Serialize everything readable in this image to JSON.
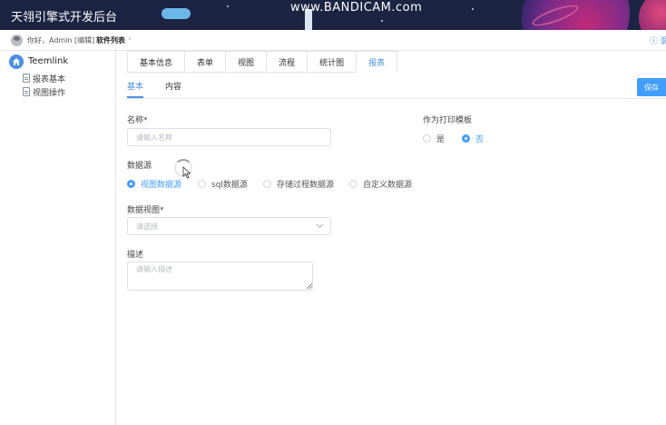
{
  "header": {
    "app_title": "天翎引擎式开发后台",
    "watermark": "www.BANDICAM.com"
  },
  "topbar": {
    "greeting": "你好，Admin [编辑]",
    "breadcrumb": "软件列表",
    "right_text": "ⓘ 调"
  },
  "sidebar": {
    "root_label": "Teemlink",
    "items": [
      {
        "label": "报表基本"
      },
      {
        "label": "视图操作"
      }
    ]
  },
  "tabs": [
    {
      "label": "基本信息",
      "active": false
    },
    {
      "label": "表单",
      "active": false
    },
    {
      "label": "视图",
      "active": false
    },
    {
      "label": "流程",
      "active": false
    },
    {
      "label": "统计图",
      "active": false
    },
    {
      "label": "报表",
      "active": true
    }
  ],
  "subtabs": [
    {
      "label": "基本",
      "active": true
    },
    {
      "label": "内容",
      "active": false
    }
  ],
  "toolbar": {
    "save_label": "保存"
  },
  "form": {
    "name": {
      "label": "名称*",
      "placeholder": "请输入名称",
      "value": ""
    },
    "print_template": {
      "label": "作为打印模板",
      "options": [
        "是",
        "否"
      ],
      "selected": "否"
    },
    "datasource": {
      "label": "数据源",
      "options": [
        "视图数据源",
        "sql数据源",
        "存储过程数据源",
        "自定义数据源"
      ],
      "selected": "视图数据源"
    },
    "data_view": {
      "label": "数据视图*",
      "placeholder": "请选择",
      "value": ""
    },
    "description": {
      "label": "描述",
      "placeholder": "请输入描述",
      "value": ""
    }
  },
  "colors": {
    "accent": "#409eff",
    "header_bg": "#1c2444"
  }
}
